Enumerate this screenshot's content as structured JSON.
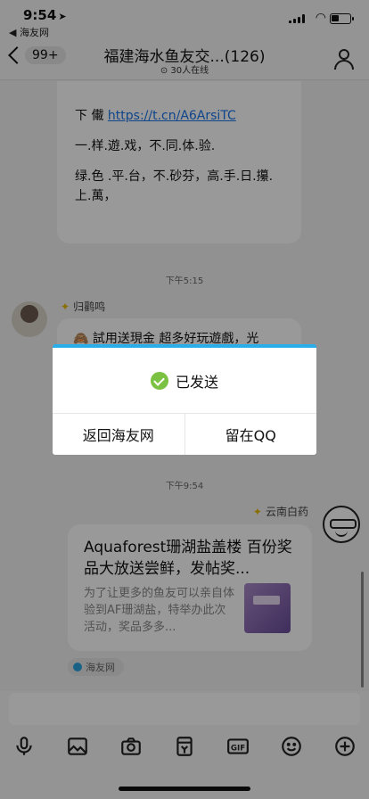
{
  "status_bar": {
    "time": "9:54",
    "back_app": "◀ 海友网"
  },
  "header": {
    "back_badge": "99+",
    "title": "福建海水鱼友交...(126)",
    "online": "30人在线"
  },
  "chat": {
    "msg1_lines": [
      "下 儎 ",
      "一.样.遊.戏，不.同.体.验.",
      "绿.色 .平.台，不.砂芬，高.手.日.攥.上.萬，"
    ],
    "msg1_link": "https://t.cn/A6ArsiTC",
    "time1": "下午5:15",
    "sender1": "归鹳鸣",
    "msg2": "🙈 試用送現金 超多好玩遊戲，光",
    "time2": "下午9:54",
    "sender2": "云南白药",
    "card": {
      "title": "Aquaforest珊湖盐盖楼 百份奖品大放送尝鲜，发帖奖...",
      "desc": "为了让更多的鱼友可以亲自体验到AF珊湖盐，特举办此次活动，奖品多多..."
    },
    "source": "海友网"
  },
  "dialog": {
    "message": "已发送",
    "left_button": "返回海友网",
    "right_button": "留在QQ"
  },
  "toolbar": [
    "mic-icon",
    "image-icon",
    "camera-icon",
    "red-packet-icon",
    "gif-icon",
    "emoji-icon",
    "plus-icon"
  ],
  "colors": {
    "accent": "#29aeea",
    "success": "#7bc142",
    "link": "#1a73e8"
  }
}
